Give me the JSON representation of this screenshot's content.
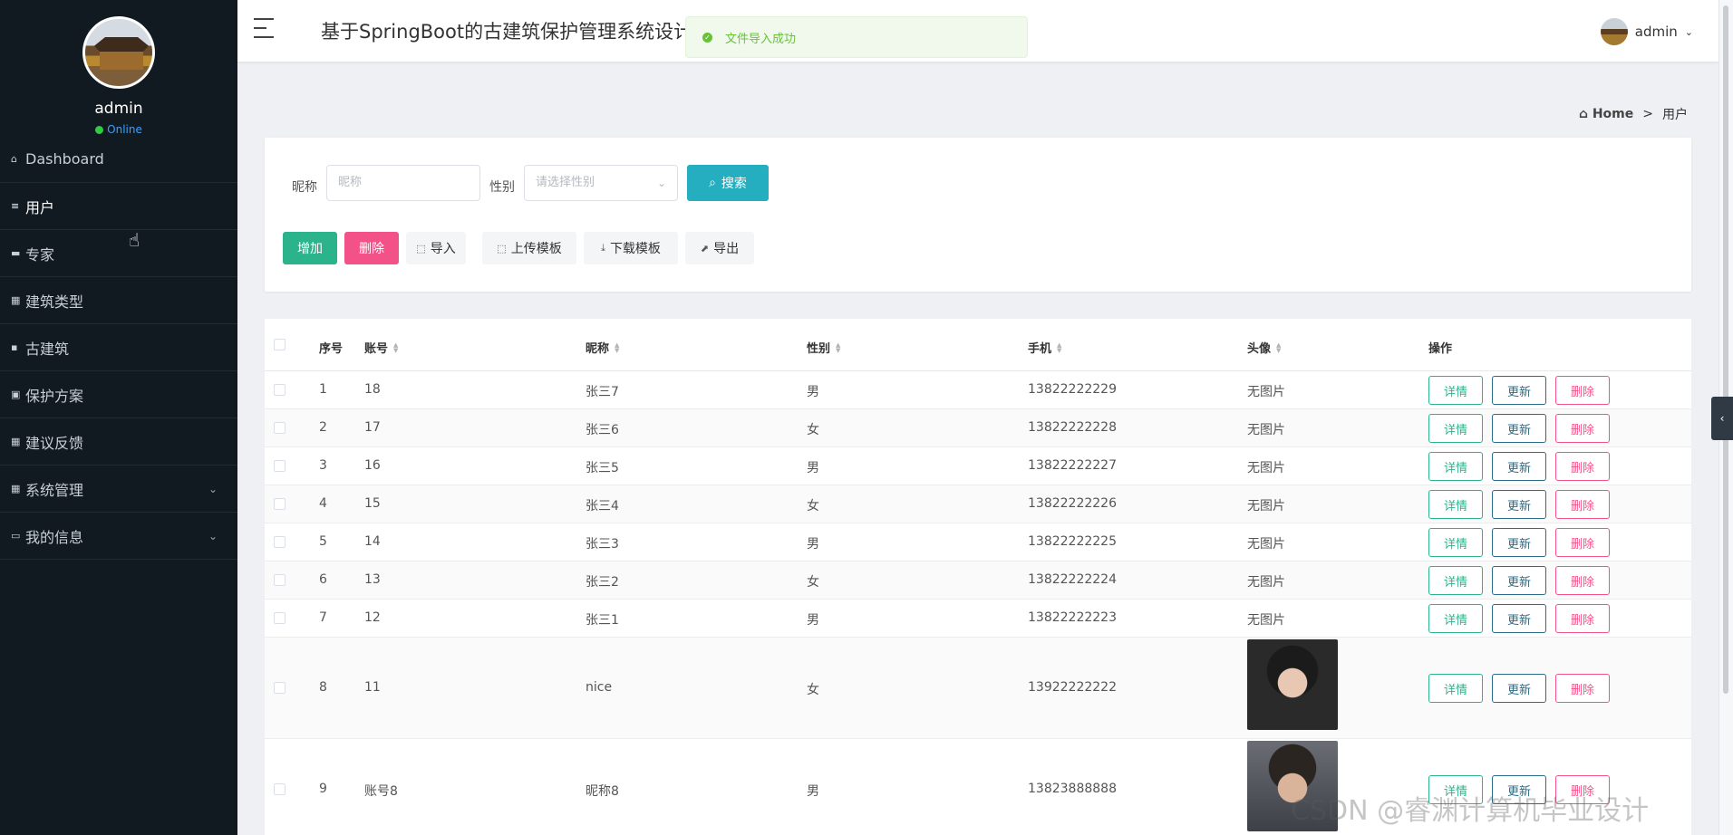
{
  "sidebar": {
    "user": {
      "name": "admin",
      "status": "Online"
    },
    "items": [
      {
        "label": "Dashboard",
        "icon": "home-icon",
        "glyph": "⌂"
      },
      {
        "label": "用户",
        "icon": "list-icon",
        "glyph": "≡"
      },
      {
        "label": "专家",
        "icon": "ticket-icon",
        "glyph": "▬"
      },
      {
        "label": "建筑类型",
        "icon": "grid-icon",
        "glyph": "▦"
      },
      {
        "label": "古建筑",
        "icon": "bookmark-icon",
        "glyph": "▪"
      },
      {
        "label": "保护方案",
        "icon": "file-icon",
        "glyph": "▣"
      },
      {
        "label": "建议反馈",
        "icon": "grid-icon",
        "glyph": "▦"
      },
      {
        "label": "系统管理",
        "icon": "grid-icon",
        "glyph": "▦"
      },
      {
        "label": "我的信息",
        "icon": "card-icon",
        "glyph": "▭"
      }
    ]
  },
  "header": {
    "title": "基于SpringBoot的古建筑保护管理系统设计",
    "user": "admin",
    "toast": "文件导入成功"
  },
  "breadcrumb": {
    "home": "Home",
    "separator": ">",
    "current": "用户"
  },
  "search": {
    "nickname_label": "昵称",
    "nickname_placeholder": "昵称",
    "gender_label": "性别",
    "gender_placeholder": "请选择性别",
    "search_button": "搜索"
  },
  "toolbar": {
    "add": "增加",
    "delete": "删除",
    "import": "导入",
    "upload_template": "上传模板",
    "download_template": "下载模板",
    "export": "导出"
  },
  "table": {
    "headers": {
      "index": "序号",
      "account": "账号",
      "nickname": "昵称",
      "gender": "性别",
      "phone": "手机",
      "avatar": "头像",
      "actions": "操作"
    },
    "action_labels": {
      "detail": "详情",
      "update": "更新",
      "delete": "删除"
    },
    "rows": [
      {
        "index": "1",
        "account": "18",
        "nickname": "张三7",
        "gender": "男",
        "phone": "13822222229",
        "avatar": "无图片"
      },
      {
        "index": "2",
        "account": "17",
        "nickname": "张三6",
        "gender": "女",
        "phone": "13822222228",
        "avatar": "无图片"
      },
      {
        "index": "3",
        "account": "16",
        "nickname": "张三5",
        "gender": "男",
        "phone": "13822222227",
        "avatar": "无图片"
      },
      {
        "index": "4",
        "account": "15",
        "nickname": "张三4",
        "gender": "女",
        "phone": "13822222226",
        "avatar": "无图片"
      },
      {
        "index": "5",
        "account": "14",
        "nickname": "张三3",
        "gender": "男",
        "phone": "13822222225",
        "avatar": "无图片"
      },
      {
        "index": "6",
        "account": "13",
        "nickname": "张三2",
        "gender": "女",
        "phone": "13822222224",
        "avatar": "无图片"
      },
      {
        "index": "7",
        "account": "12",
        "nickname": "张三1",
        "gender": "男",
        "phone": "13822222223",
        "avatar": "无图片"
      },
      {
        "index": "8",
        "account": "11",
        "nickname": "nice",
        "gender": "女",
        "phone": "13922222222",
        "avatar": ""
      },
      {
        "index": "9",
        "account": "账号8",
        "nickname": "昵称8",
        "gender": "男",
        "phone": "13823888888",
        "avatar": ""
      }
    ]
  },
  "watermark": "CSDN @睿渊计算机毕业设计",
  "colors": {
    "sidebar_bg": "#121a21",
    "primary": "#24aebf",
    "success": "#2bb38b",
    "danger": "#f25288",
    "update": "#2a6d89"
  }
}
